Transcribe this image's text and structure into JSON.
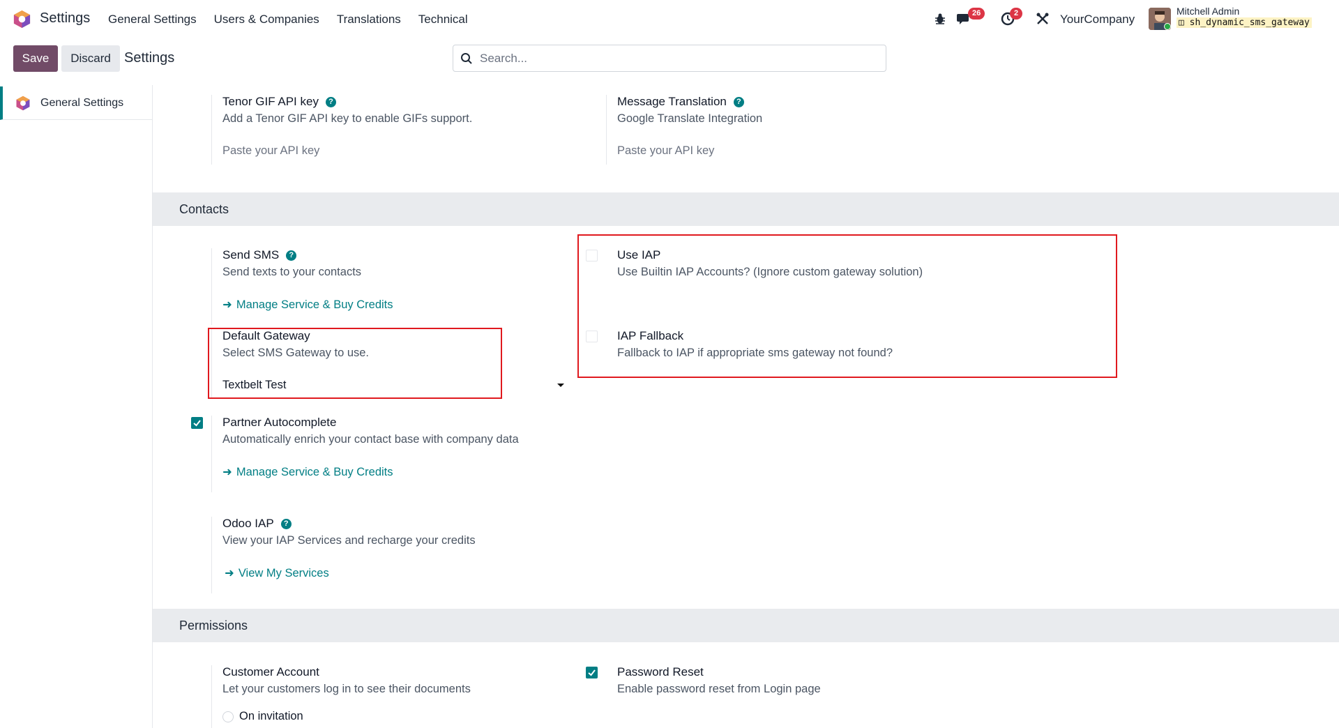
{
  "navbar": {
    "app_name": "Settings",
    "menu": [
      "General Settings",
      "Users & Companies",
      "Translations",
      "Technical"
    ],
    "messages_count": "26",
    "activities_count": "2",
    "company": "YourCompany",
    "user_name": "Mitchell Admin",
    "database": "sh_dynamic_sms_gateway"
  },
  "control_panel": {
    "save_label": "Save",
    "discard_label": "Discard",
    "breadcrumb": "Settings",
    "search_placeholder": "Search..."
  },
  "sidebar": {
    "items": [
      {
        "label": "General Settings"
      }
    ]
  },
  "settings_top": {
    "tenor": {
      "title": "Tenor GIF API key",
      "desc": "Add a Tenor GIF API key to enable GIFs support.",
      "placeholder": "Paste your API key"
    },
    "translation": {
      "title": "Message Translation",
      "desc": "Google Translate Integration",
      "placeholder": "Paste your API key"
    }
  },
  "contacts": {
    "header": "Contacts",
    "send_sms": {
      "title": "Send SMS",
      "desc": "Send texts to your contacts",
      "link": "Manage Service & Buy Credits"
    },
    "default_gateway": {
      "title": "Default Gateway",
      "desc": "Select SMS Gateway to use.",
      "value": "Textbelt Test"
    },
    "use_iap": {
      "title": "Use IAP",
      "desc": "Use Builtin IAP Accounts? (Ignore custom gateway solution)",
      "checked": false
    },
    "iap_fallback": {
      "title": "IAP Fallback",
      "desc": "Fallback to IAP if appropriate sms gateway not found?",
      "checked": false
    },
    "partner_autocomplete": {
      "title": "Partner Autocomplete",
      "desc": "Automatically enrich your contact base with company data",
      "link": "Manage Service & Buy Credits",
      "checked": true
    },
    "odoo_iap": {
      "title": "Odoo IAP",
      "desc": "View your IAP Services and recharge your credits",
      "link": "View My Services"
    }
  },
  "permissions": {
    "header": "Permissions",
    "customer_account": {
      "title": "Customer Account",
      "desc": "Let your customers log in to see their documents",
      "option": "On invitation"
    },
    "password_reset": {
      "title": "Password Reset",
      "desc": "Enable password reset from Login page",
      "checked": true
    }
  },
  "colors": {
    "brand": "#714b67",
    "accent": "#017e84",
    "highlight": "#e0191e"
  }
}
